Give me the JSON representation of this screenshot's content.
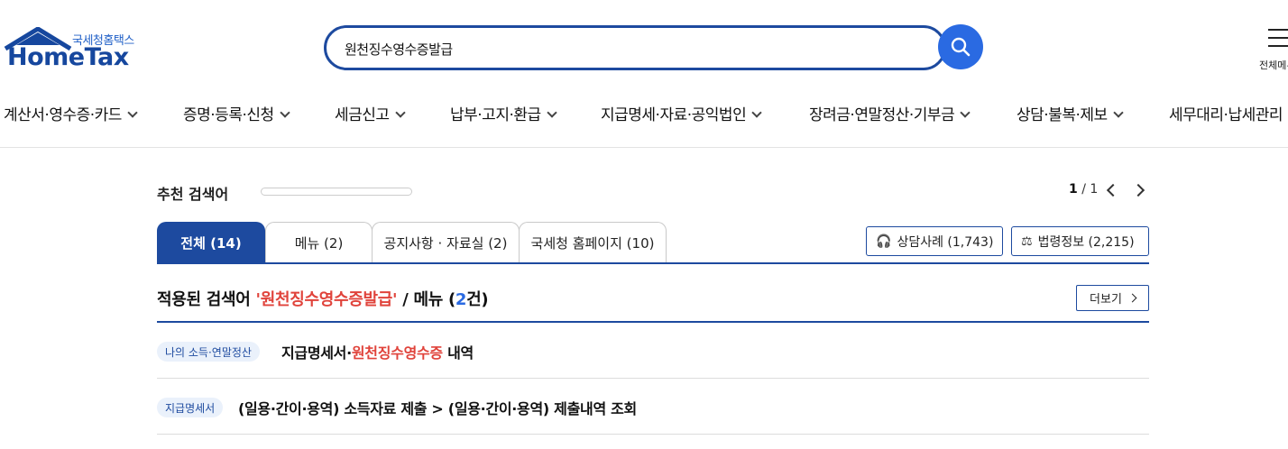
{
  "header": {
    "logo_sub": "국세청홈택스",
    "logo_main": "HomeTax",
    "search_query": "원천징수영수증발급",
    "menu_all_label": "전체메뉴"
  },
  "gnb": [
    {
      "label": "계산서·영수증·카드"
    },
    {
      "label": "증명·등록·신청"
    },
    {
      "label": "세금신고"
    },
    {
      "label": "납부·고지·환급"
    },
    {
      "label": "지급명세·자료·공익법인"
    },
    {
      "label": "장려금·연말정산·기부금"
    },
    {
      "label": "상담·불복·제보"
    },
    {
      "label": "세무대리·납세관리"
    }
  ],
  "recommended": {
    "title": "추천 검색어",
    "page_current": "1",
    "page_sep": " / ",
    "page_total": "1"
  },
  "tabs": [
    {
      "label": "전체 (14)"
    },
    {
      "label": "메뉴 (2)"
    },
    {
      "label": "공지사항 · 자료실 (2)"
    },
    {
      "label": "국세청 홈페이지 (10)"
    }
  ],
  "side_buttons": {
    "consult_label": "상담사례 (1,743)",
    "law_label": "법령정보 (2,215)"
  },
  "applied": {
    "prefix": "적용된 검색어 ",
    "keyword": "'원천징수영수증발급'",
    "middle": " / 메뉴 (",
    "count": "2",
    "suffix": "건)",
    "more_label": "더보기"
  },
  "results": [
    {
      "tag": "나의 소득·연말정산",
      "title_pre": "지급명세서·",
      "title_hl": "원천징수영수증",
      "title_post": " 내역"
    },
    {
      "tag": "지급명세서",
      "title_pre": "(일용·간이·용역) 소득자료 제출 > (일용·간이·용역) 제출내역 조회",
      "title_hl": "",
      "title_post": ""
    }
  ],
  "colors": {
    "brand_navy": "#1d4a9f",
    "accent_blue": "#2a6ae2",
    "highlight_red": "#e0433b"
  }
}
